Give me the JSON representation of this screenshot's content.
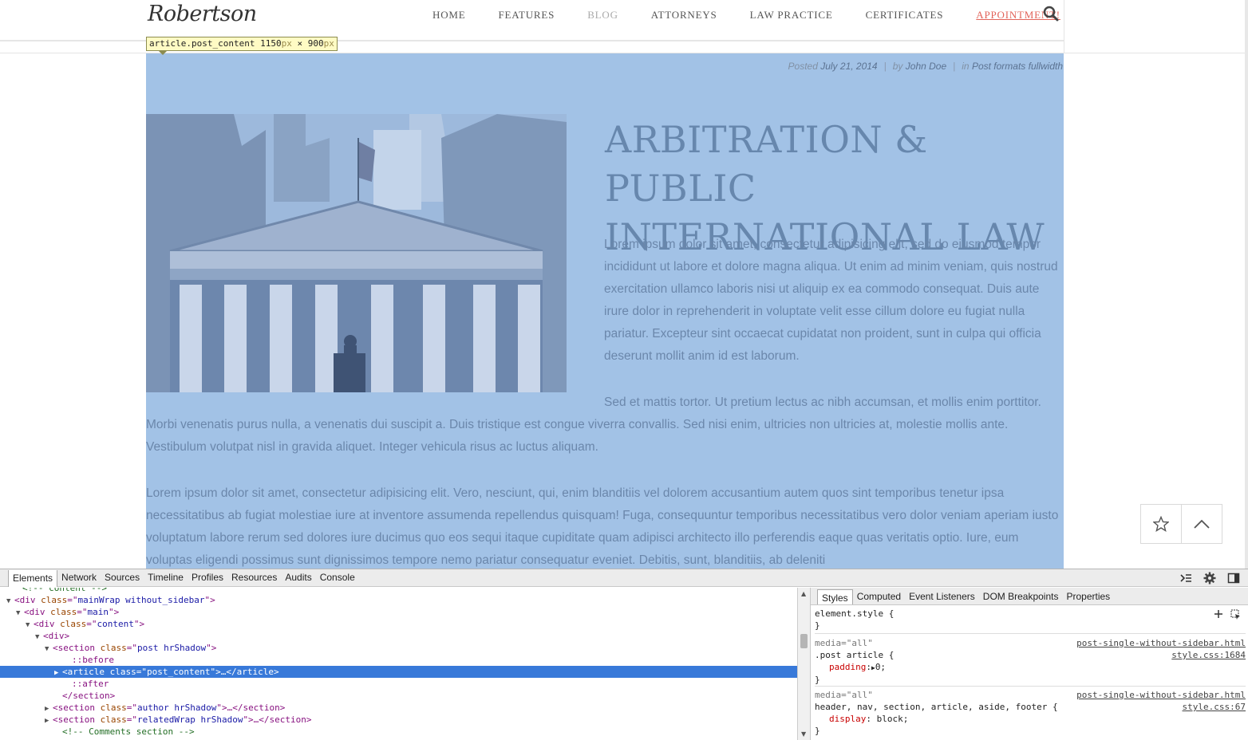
{
  "site": {
    "logo": "Robertson",
    "nav": [
      "HOME",
      "FEATURES",
      "BLOG",
      "ATTORNEYS",
      "LAW PRACTICE",
      "CERTIFICATES",
      "APPOINTMENT!"
    ]
  },
  "inspector_tooltip": {
    "selector": "article.post_content",
    "width": "1150",
    "height": "900",
    "unit": "px",
    "times": " × "
  },
  "post": {
    "meta": {
      "posted_label": "Posted",
      "date": "July 21, 2014",
      "by_label": "by",
      "author": "John Doe",
      "in_label": "in",
      "category": "Post formats fullwidth",
      "separator": "|"
    },
    "title": "ARBITRATION & PUBLIC INTERNATIONAL LAW",
    "paragraphs": [
      "Lorem ipsum dolor sit amet, consectetur adipisicing elit, sed do eiusmod tempor incididunt ut labore et dolore magna aliqua. Ut enim ad minim veniam, quis nostrud exercitation ullamco laboris nisi ut aliquip ex ea commodo consequat. Duis aute irure dolor in reprehenderit in voluptate velit esse cillum dolore eu fugiat nulla pariatur. Excepteur sint occaecat cupidatat non proident, sunt in culpa qui officia deserunt mollit anim id est laborum.",
      "Sed et mattis tortor. Ut pretium lectus ac nibh accumsan, et mollis enim porttitor. Morbi venenatis purus nulla, a venenatis dui suscipit a. Duis tristique est congue viverra convallis. Sed nisi enim, ultricies non ultricies at, molestie mollis ante. Vestibulum volutpat nisl in gravida aliquet. Integer vehicula risus ac luctus aliquam.",
      "Lorem ipsum dolor sit amet, consectetur adipisicing elit. Vero, nesciunt, qui, enim blanditiis vel dolorem accusantium autem quos sint temporibus tenetur ipsa necessitatibus ab fugiat molestiae iure at inventore assumenda repellendus quisquam! Fuga, consequuntur temporibus necessitatibus vero dolor veniam aperiam iusto voluptatum labore rerum sed dolores iure ducimus quo eos sequi itaque cupiditate quam adipisci architecto illo perferendis eaque quas veritatis optio. Iure, eum voluptas eligendi possimus sunt dignissimos tempore nemo pariatur consequatur eveniet. Debitis, sunt, blanditiis, ab deleniti"
    ]
  },
  "float_actions": {
    "star_icon": "star-icon",
    "up_icon": "chevron-up-icon"
  },
  "devtools": {
    "tabs": [
      "Elements",
      "Network",
      "Sources",
      "Timeline",
      "Profiles",
      "Resources",
      "Audits",
      "Console"
    ],
    "active_tab": "Elements",
    "dom_lines": [
      {
        "parts": [
          [
            "cm",
            "<!-- content -->"
          ]
        ],
        "toggle": ""
      },
      {
        "parts": [
          [
            "tg",
            "<div "
          ],
          [
            "at",
            "class"
          ],
          [
            "tg",
            "=\""
          ],
          [
            "av",
            "mainWrap without_sidebar"
          ],
          [
            "tg",
            "\">"
          ]
        ],
        "toggle": "▼"
      },
      {
        "parts": [
          [
            "tg",
            "<div "
          ],
          [
            "at",
            "class"
          ],
          [
            "tg",
            "=\""
          ],
          [
            "av",
            "main"
          ],
          [
            "tg",
            "\">"
          ]
        ],
        "toggle": "▼"
      },
      {
        "parts": [
          [
            "tg",
            "<div "
          ],
          [
            "at",
            "class"
          ],
          [
            "tg",
            "=\""
          ],
          [
            "av",
            "content"
          ],
          [
            "tg",
            "\">"
          ]
        ],
        "toggle": "▼"
      },
      {
        "parts": [
          [
            "tg",
            "<div>"
          ]
        ],
        "toggle": "▼"
      },
      {
        "parts": [
          [
            "tg",
            "<section "
          ],
          [
            "at",
            "class"
          ],
          [
            "tg",
            "=\""
          ],
          [
            "av",
            "post hrShadow"
          ],
          [
            "tg",
            "\">"
          ]
        ],
        "toggle": "▼"
      },
      {
        "parts": [
          [
            "ps",
            "::before"
          ]
        ],
        "toggle": ""
      },
      {
        "parts": [
          [
            "tg",
            "<article "
          ],
          [
            "at",
            "class"
          ],
          [
            "tg",
            "=\""
          ],
          [
            "av",
            "post_content"
          ],
          [
            "tg",
            "\">…</article>"
          ]
        ],
        "toggle": "▶"
      },
      {
        "parts": [
          [
            "ps",
            "::after"
          ]
        ],
        "toggle": ""
      },
      {
        "parts": [
          [
            "tg",
            "</section>"
          ]
        ],
        "toggle": ""
      },
      {
        "parts": [
          [
            "tg",
            "<section "
          ],
          [
            "at",
            "class"
          ],
          [
            "tg",
            "=\""
          ],
          [
            "av",
            "author hrShadow"
          ],
          [
            "tg",
            "\">…</section>"
          ]
        ],
        "toggle": "▶"
      },
      {
        "parts": [
          [
            "tg",
            "<section "
          ],
          [
            "at",
            "class"
          ],
          [
            "tg",
            "=\""
          ],
          [
            "av",
            "relatedWrap hrShadow"
          ],
          [
            "tg",
            "\">…</section>"
          ]
        ],
        "toggle": "▶"
      },
      {
        "parts": [
          [
            "cm",
            "<!-- Comments section -->"
          ]
        ],
        "toggle": ""
      }
    ],
    "styles_tabs": [
      "Styles",
      "Computed",
      "Event Listeners",
      "DOM Breakpoints",
      "Properties"
    ],
    "styles": {
      "rule0_selector": "element.style {",
      "close": "}",
      "rule1_media": "media=\"all\"",
      "rule1_source1": "post-single-without-sidebar.html",
      "rule1_source2": "style.css:1684",
      "rule1_selector": ".post article {",
      "rule1_prop": "padding",
      "rule1_val": "0;",
      "rule2_media": "media=\"all\"",
      "rule2_source1": "post-single-without-sidebar.html",
      "rule2_source2": "style.css:67",
      "rule2_selector": "header, nav, section, article, aside, footer {",
      "rule2_prop": "display",
      "rule2_val": "block;"
    }
  }
}
